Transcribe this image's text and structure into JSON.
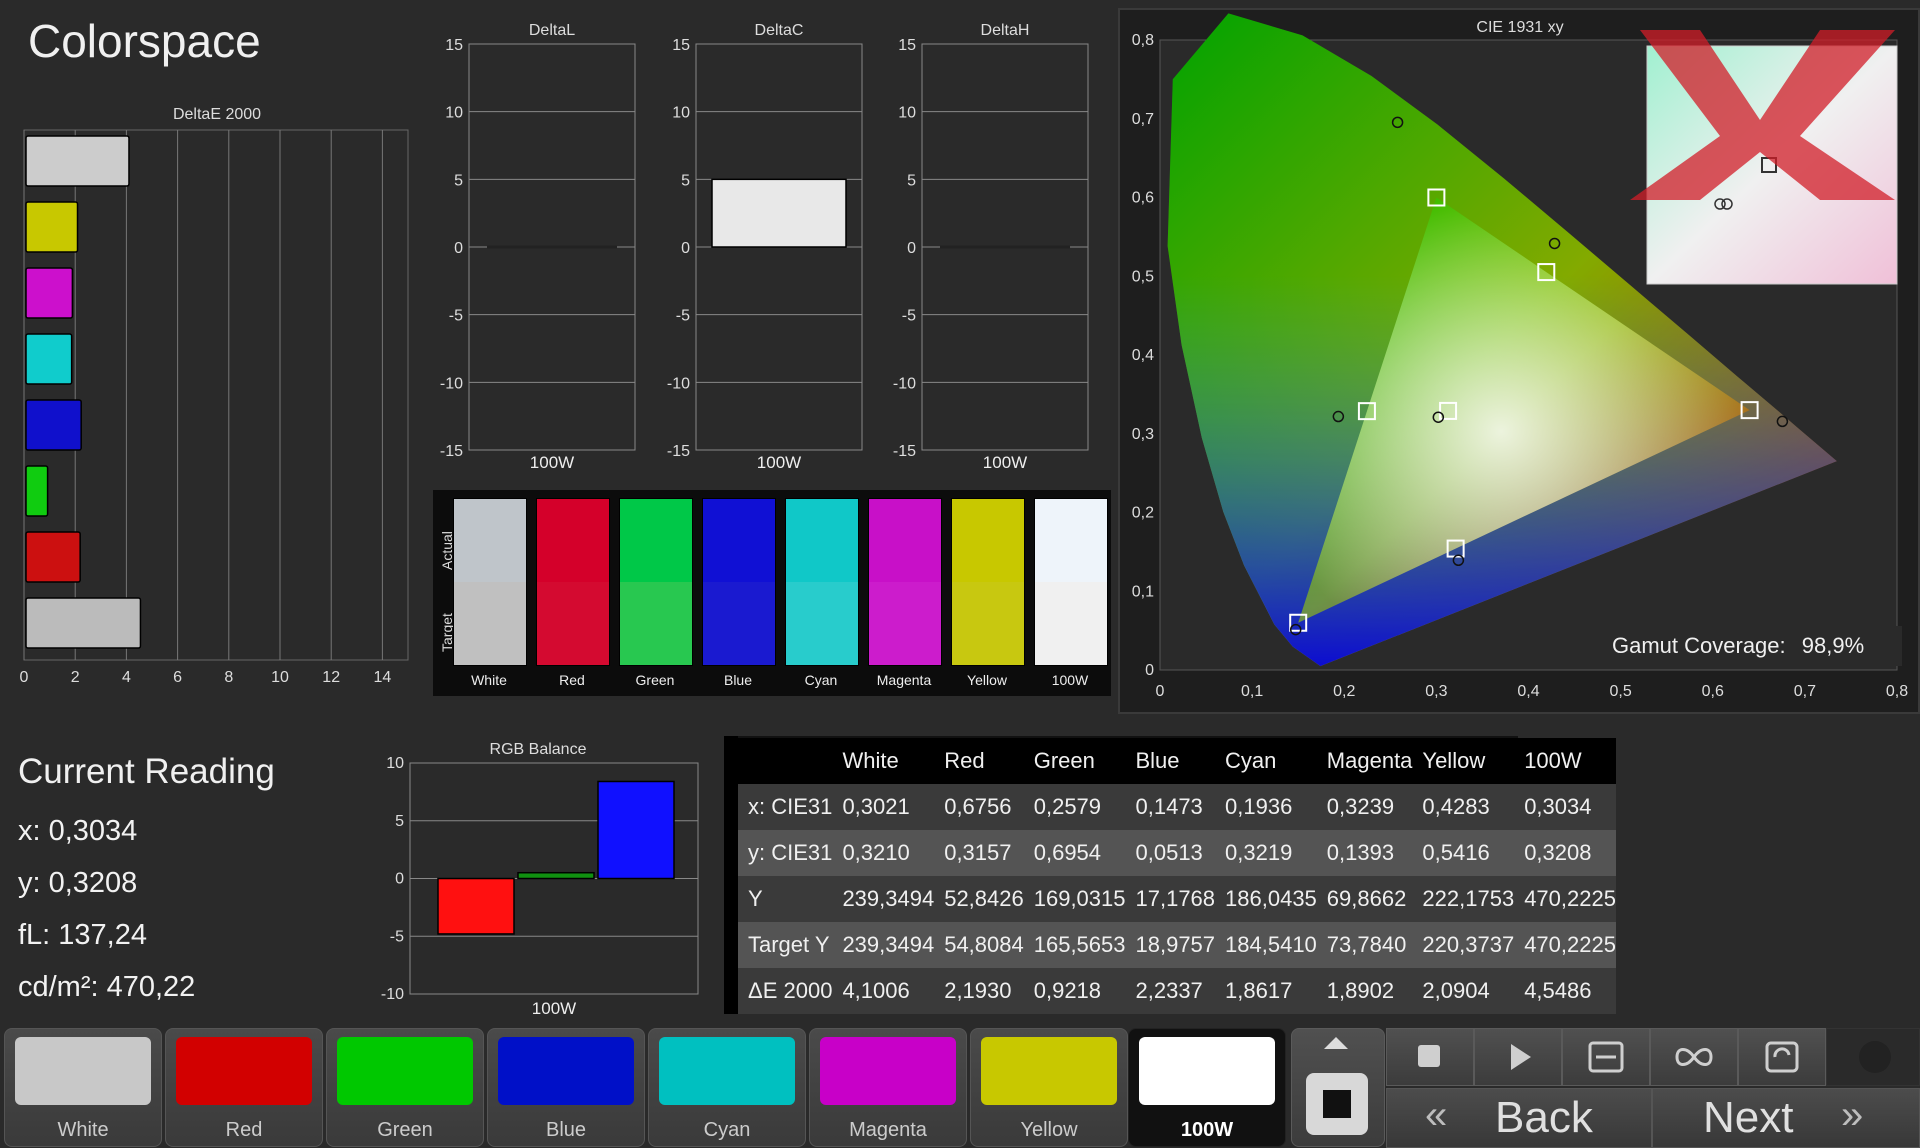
{
  "app": {
    "title": "Colorspace"
  },
  "deltae_chart": {
    "title": "DeltaE 2000",
    "x_ticks": [
      "0",
      "2",
      "4",
      "6",
      "8",
      "10",
      "12",
      "14"
    ],
    "bars": [
      {
        "name": "White",
        "value": 4.1006,
        "color": "#cccccc"
      },
      {
        "name": "Yellow",
        "value": 2.0904,
        "color": "#c8c800"
      },
      {
        "name": "Magenta",
        "value": 1.8902,
        "color": "#cc10cc"
      },
      {
        "name": "Cyan",
        "value": 1.8617,
        "color": "#10cccc"
      },
      {
        "name": "Blue",
        "value": 2.2337,
        "color": "#1010cc"
      },
      {
        "name": "Green",
        "value": 0.9218,
        "color": "#10cc10"
      },
      {
        "name": "Red",
        "value": 2.193,
        "color": "#cc1010"
      },
      {
        "name": "100W",
        "value": 4.5486,
        "color": "#bbbbbb"
      }
    ]
  },
  "delta_charts": [
    {
      "title": "DeltaL",
      "category": "100W",
      "value": 0
    },
    {
      "title": "DeltaC",
      "category": "100W",
      "value": 5
    },
    {
      "title": "DeltaH",
      "category": "100W",
      "value": 0
    }
  ],
  "delta_ticks": [
    "15",
    "10",
    "5",
    "0",
    "-5",
    "-10",
    "-15"
  ],
  "swatches": {
    "side_labels": {
      "actual": "Actual",
      "target": "Target"
    },
    "items": [
      {
        "label": "White",
        "actual": "#bfc5ca",
        "target": "#c0c0c0"
      },
      {
        "label": "Red",
        "actual": "#d4002a",
        "target": "#d40a30"
      },
      {
        "label": "Green",
        "actual": "#00c848",
        "target": "#28c850"
      },
      {
        "label": "Blue",
        "actual": "#1010d4",
        "target": "#1a1ad0"
      },
      {
        "label": "Cyan",
        "actual": "#10c8c8",
        "target": "#28cccc"
      },
      {
        "label": "Magenta",
        "actual": "#c810c8",
        "target": "#cc1ccc"
      },
      {
        "label": "Yellow",
        "actual": "#c8c800",
        "target": "#c8c810"
      },
      {
        "label": "100W",
        "actual": "#eef4fa",
        "target": "#f0f0f0"
      }
    ]
  },
  "cie": {
    "title": "CIE 1931 xy",
    "x_ticks": [
      "0",
      "0,1",
      "0,2",
      "0,3",
      "0,4",
      "0,5",
      "0,6",
      "0,7",
      "0,8"
    ],
    "y_ticks": [
      "0",
      "0,1",
      "0,2",
      "0,3",
      "0,4",
      "0,5",
      "0,6",
      "0,7",
      "0,8"
    ],
    "gamut_label": "Gamut Coverage:",
    "gamut_value": "98,9%"
  },
  "current_reading": {
    "title": "Current Reading",
    "x": "x: 0,3034",
    "y": "y: 0,3208",
    "fl": "fL: 137,24",
    "cdm": "cd/m²: 470,22"
  },
  "rgb_balance": {
    "title": "RGB Balance",
    "category": "100W",
    "y_ticks": [
      "10",
      "5",
      "0",
      "-5",
      "-10"
    ],
    "series": [
      {
        "name": "R",
        "value": -4.8,
        "color": "#ff1010"
      },
      {
        "name": "G",
        "value": 0.5,
        "color": "#109010"
      },
      {
        "name": "B",
        "value": 8.4,
        "color": "#1010ff"
      }
    ]
  },
  "table": {
    "headers": [
      "",
      "White",
      "Red",
      "Green",
      "Blue",
      "Cyan",
      "Magenta",
      "Yellow",
      "100W"
    ],
    "rows": [
      [
        "x: CIE31",
        "0,3021",
        "0,6756",
        "0,2579",
        "0,1473",
        "0,1936",
        "0,3239",
        "0,4283",
        "0,3034"
      ],
      [
        "y: CIE31",
        "0,3210",
        "0,3157",
        "0,6954",
        "0,0513",
        "0,3219",
        "0,1393",
        "0,5416",
        "0,3208"
      ],
      [
        "Y",
        "239,3494",
        "52,8426",
        "169,0315",
        "17,1768",
        "186,0435",
        "69,8662",
        "222,1753",
        "470,2225"
      ],
      [
        "Target Y",
        "239,3494",
        "54,8084",
        "165,5653",
        "18,9757",
        "184,5410",
        "73,7840",
        "220,3737",
        "470,2225"
      ],
      [
        "ΔE 2000",
        "4,1006",
        "2,1930",
        "0,9218",
        "2,2337",
        "1,8617",
        "1,8902",
        "2,0904",
        "4,5486"
      ]
    ]
  },
  "bottom_tiles": [
    {
      "label": "White",
      "color": "#c8c8c8"
    },
    {
      "label": "Red",
      "color": "#d20000"
    },
    {
      "label": "Green",
      "color": "#00c800"
    },
    {
      "label": "Blue",
      "color": "#0010c8"
    },
    {
      "label": "Cyan",
      "color": "#00c0c0"
    },
    {
      "label": "Magenta",
      "color": "#c800c8"
    },
    {
      "label": "Yellow",
      "color": "#c8c800"
    },
    {
      "label": "100W",
      "color": "#ffffff"
    }
  ],
  "nav": {
    "back": "Back",
    "next": "Next",
    "back_glyph": "«",
    "next_glyph": "»"
  }
}
